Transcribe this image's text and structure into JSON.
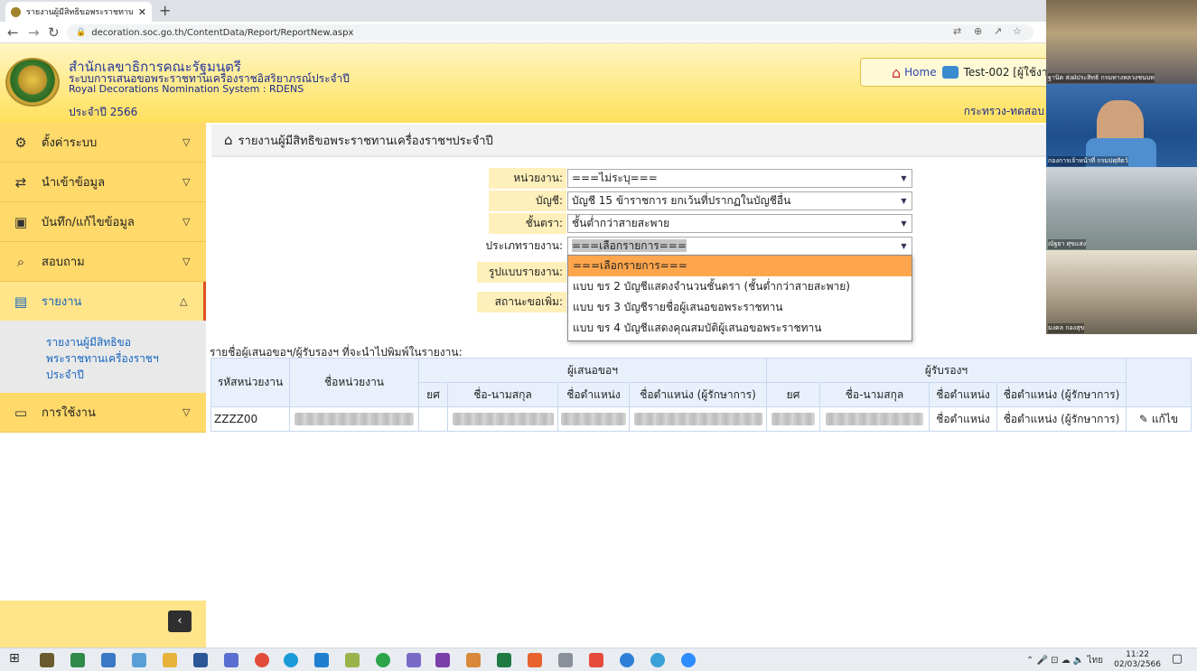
{
  "browser": {
    "tab_title": "รายงานผู้มีสิทธิขอพระราชทานเครื่อง",
    "url": "decoration.soc.go.th/ContentData/Report/ReportNew.aspx"
  },
  "header": {
    "org_name": "สำนักเลขาธิการคณะรัฐมนตรี",
    "system_th": "ระบบการเสนอขอพระราชทานเครื่องราชอิสริยาภรณ์ประจำปี",
    "system_en": "Royal Decorations Nomination System : RDENS",
    "year": "ประจำปี 2566",
    "home_label": "Home",
    "user_label": "Test-002 [ผู้ใช้งา",
    "ministry": "กระทรวง-ทดสอบ"
  },
  "sidebar": {
    "items": [
      {
        "label": "ตั้งค่าระบบ",
        "icon": "gear-icon"
      },
      {
        "label": "นำเข้าข้อมูล",
        "icon": "swap-icon"
      },
      {
        "label": "บันทึก/แก้ไขข้อมูล",
        "icon": "save-icon"
      },
      {
        "label": "สอบถาม",
        "icon": "search-icon"
      },
      {
        "label": "รายงาน",
        "icon": "report-icon"
      },
      {
        "label": "การใช้งาน",
        "icon": "monitor-icon"
      }
    ],
    "sub_item": "รายงานผู้มีสิทธิขอพระราชทานเครื่องราชฯ ประจำปี"
  },
  "breadcrumb": "รายงานผู้มีสิทธิขอพระราชทานเครื่องราชฯประจำปี",
  "form": {
    "unit_label": "หน่วยงาน:",
    "unit_value": "===ไม่ระบุ===",
    "account_label": "บัญชี:",
    "account_value": "บัญชี 15 ข้าราชการ ยกเว้นที่ปรากฏในบัญชีอื่น",
    "class_label": "ชั้นตรา:",
    "class_value": "ชั้นต่ำกว่าสายสะพาย",
    "type_label": "ประเภทรายงาน:",
    "type_value": "===เลือกรายการ===",
    "format_label": "รูปแบบรายงาน:",
    "status_label": "สถานะขอเพิ่ม:"
  },
  "dropdown_options": [
    "===เลือกรายการ===",
    "แบบ ขร 2 บัญชีแสดงจำนวนชั้นตรา (ชั้นต่ำกว่าสายสะพาย)",
    "แบบ ขร 3 บัญชีรายชื่อผู้เสนอขอพระราชทาน",
    "แบบ ขร 4 บัญชีแสดงคุณสมบัติผู้เสนอขอพระราชทาน"
  ],
  "table": {
    "caption": "รายชื่อผู้เสนอขอฯ/ผู้รับรองฯ ที่จะนำไปพิมพ์ในรายงาน:",
    "col_unit_code": "รหัสหน่วยงาน",
    "col_unit_name": "ชื่อหน่วยงาน",
    "group_proposer": "ผู้เสนอขอฯ",
    "group_certifier": "ผู้รับรองฯ",
    "sub_rank": "ยศ",
    "sub_name": "ชื่อ-นามสกุล",
    "sub_position": "ชื่อตำแหน่ง",
    "sub_position_acting": "ชื่อตำแหน่ง (ผู้รักษาการ)",
    "row": {
      "unit_code": "ZZZZ00",
      "cert_position": "ชื่อตำแหน่ง",
      "cert_position_acting": "ชื่อตำแหน่ง (ผู้รักษาการ)",
      "edit_label": "แก้ไข"
    }
  },
  "video": {
    "names": [
      "ฐานิต ส่งฝ่ประสิทธิ กรมทางหลวงชนบท",
      "กองการเจ้าหน้าที่ กรมปศุสัตว์",
      "ณัฐยา ศุขแสง",
      "มงคล กองสุข"
    ]
  },
  "taskbar": {
    "lang": "ไทย",
    "time": "11:22",
    "date": "02/03/2566"
  }
}
